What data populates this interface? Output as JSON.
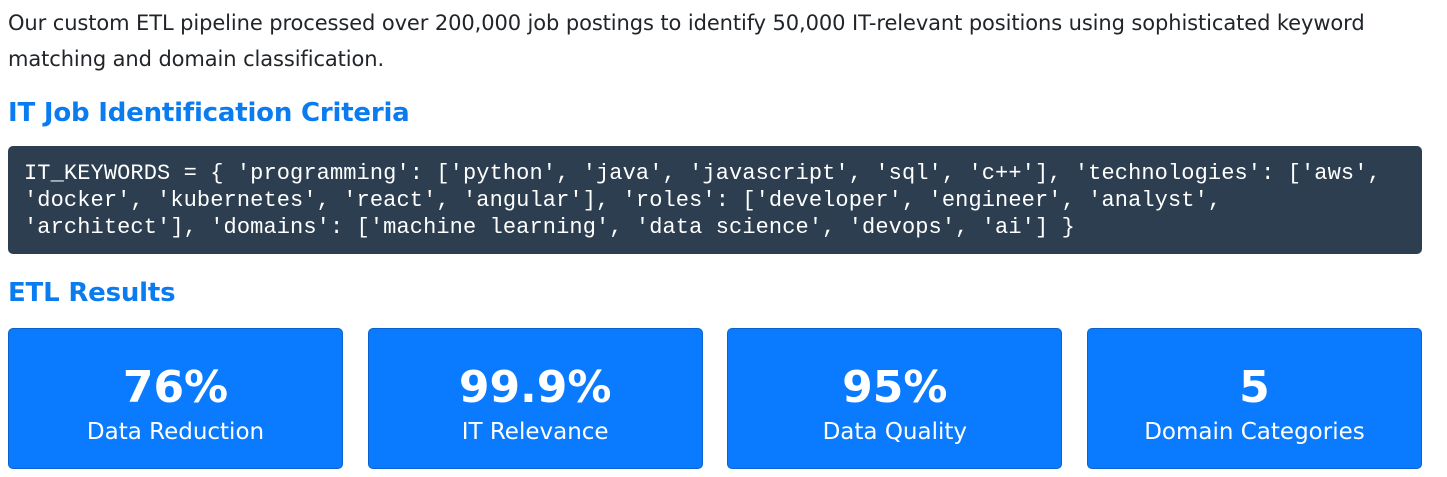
{
  "intro": {
    "text": "Our custom ETL pipeline processed over 200,000 job postings to identify 50,000 IT-relevant positions using sophisticated keyword matching and domain classification."
  },
  "criteria": {
    "heading": "IT Job Identification Criteria",
    "code": "IT_KEYWORDS = { 'programming': ['python', 'java', 'javascript', 'sql', 'c++'], 'technologies': ['aws', 'docker', 'kubernetes', 'react', 'angular'], 'roles': ['developer', 'engineer', 'analyst', 'architect'], 'domains': ['machine learning', 'data science', 'devops', 'ai'] }"
  },
  "results": {
    "heading": "ETL Results",
    "cards": [
      {
        "value": "76%",
        "label": "Data Reduction"
      },
      {
        "value": "99.9%",
        "label": "IT Relevance"
      },
      {
        "value": "95%",
        "label": "Data Quality"
      },
      {
        "value": "5",
        "label": "Domain Categories"
      }
    ]
  },
  "colors": {
    "heading": "#0a7cf0",
    "code_background": "#2c3e50",
    "card_background": "#0a7bff"
  }
}
